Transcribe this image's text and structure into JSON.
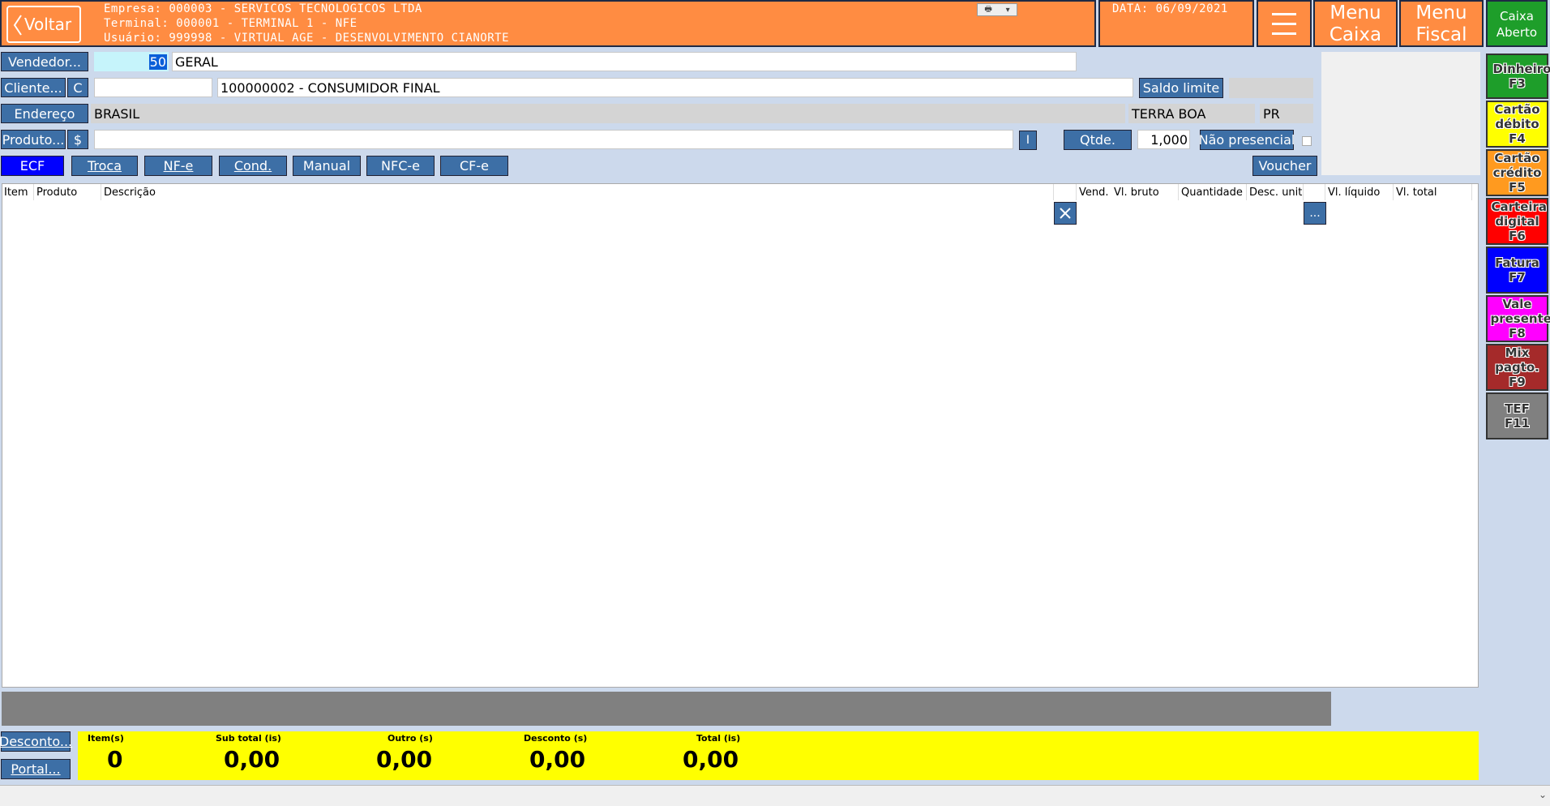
{
  "header": {
    "back_label": "Voltar",
    "empresa": "Empresa: 000003 - SERVICOS TECNOLOGICOS LTDA",
    "terminal": "Terminal: 000001 - TERMINAL 1 - NFE",
    "usuario": "Usuário: 999998 - VIRTUAL AGE - DESENVOLVIMENTO CIANORTE",
    "data": "DATA: 06/09/2021",
    "menu_caixa": [
      "Menu",
      "Caixa"
    ],
    "menu_fiscal": [
      "Menu",
      "Fiscal"
    ],
    "caixa_status": [
      "Caixa",
      "Aberto"
    ],
    "colors": {
      "header_bg": "#ff8c42",
      "caixa_bg": "#1e9e2a"
    }
  },
  "form": {
    "vendedor_label": "Vendedor...",
    "vendedor_code": "50",
    "vendedor_name": "GERAL",
    "cliente_label": "Cliente...",
    "cliente_c": "C",
    "cliente_code": "",
    "cliente_name": "100000002 - CONSUMIDOR FINAL",
    "saldo_label": "Saldo limite",
    "saldo_value": "",
    "endereco_label": "Endereço",
    "pais": "BRASIL",
    "cidade": "TERRA BOA",
    "uf": "PR",
    "produto_label": "Produto...",
    "produto_dollar": "$",
    "produto_value": "",
    "i_label": "I",
    "qtde_label": "Qtde.",
    "qtde_value": "1,000",
    "nao_presencial_label": "Não presencial",
    "voucher_label": "Voucher"
  },
  "tabs": [
    {
      "label": "ECF",
      "active": true
    },
    {
      "label": "Troca"
    },
    {
      "label": "NF-e"
    },
    {
      "label": "Cond."
    },
    {
      "label": "Manual"
    },
    {
      "label": "NFC-e"
    },
    {
      "label": "CF-e"
    }
  ],
  "grid": {
    "columns": [
      "Item",
      "Produto",
      "Descrição",
      "Vend.",
      "Vl. bruto",
      "Quantidade",
      "Desc. unit",
      "Vl. líquido",
      "Vl. total"
    ],
    "rows": [],
    "dots_label": "..."
  },
  "payments": [
    {
      "label": "Dinheiro F3",
      "color": "#1e9e2a"
    },
    {
      "label": "Cartão débito F4",
      "color": "#ffff00"
    },
    {
      "label": "Cartão crédito F5",
      "color": "#ff9a1f"
    },
    {
      "label": "Carteira digital F6",
      "color": "#ff0000"
    },
    {
      "label": "Fatura F7",
      "color": "#0000ff"
    },
    {
      "label": "Vale presente F8",
      "color": "#ff00ff"
    },
    {
      "label": "Mix pagto. F9",
      "color": "#a52a2a"
    },
    {
      "label": "TEF F11",
      "color": "#808080"
    }
  ],
  "bottom": {
    "desconto_label": "Desconto...",
    "portal_label": "Portal...",
    "totals": [
      {
        "label": "Item(s)",
        "value": "0"
      },
      {
        "label": "Sub total (is)",
        "value": "0,00"
      },
      {
        "label": "Outro (s)",
        "value": "0,00"
      },
      {
        "label": "Desconto (s)",
        "value": "0,00"
      },
      {
        "label": "Total (is)",
        "value": "0,00"
      }
    ]
  }
}
